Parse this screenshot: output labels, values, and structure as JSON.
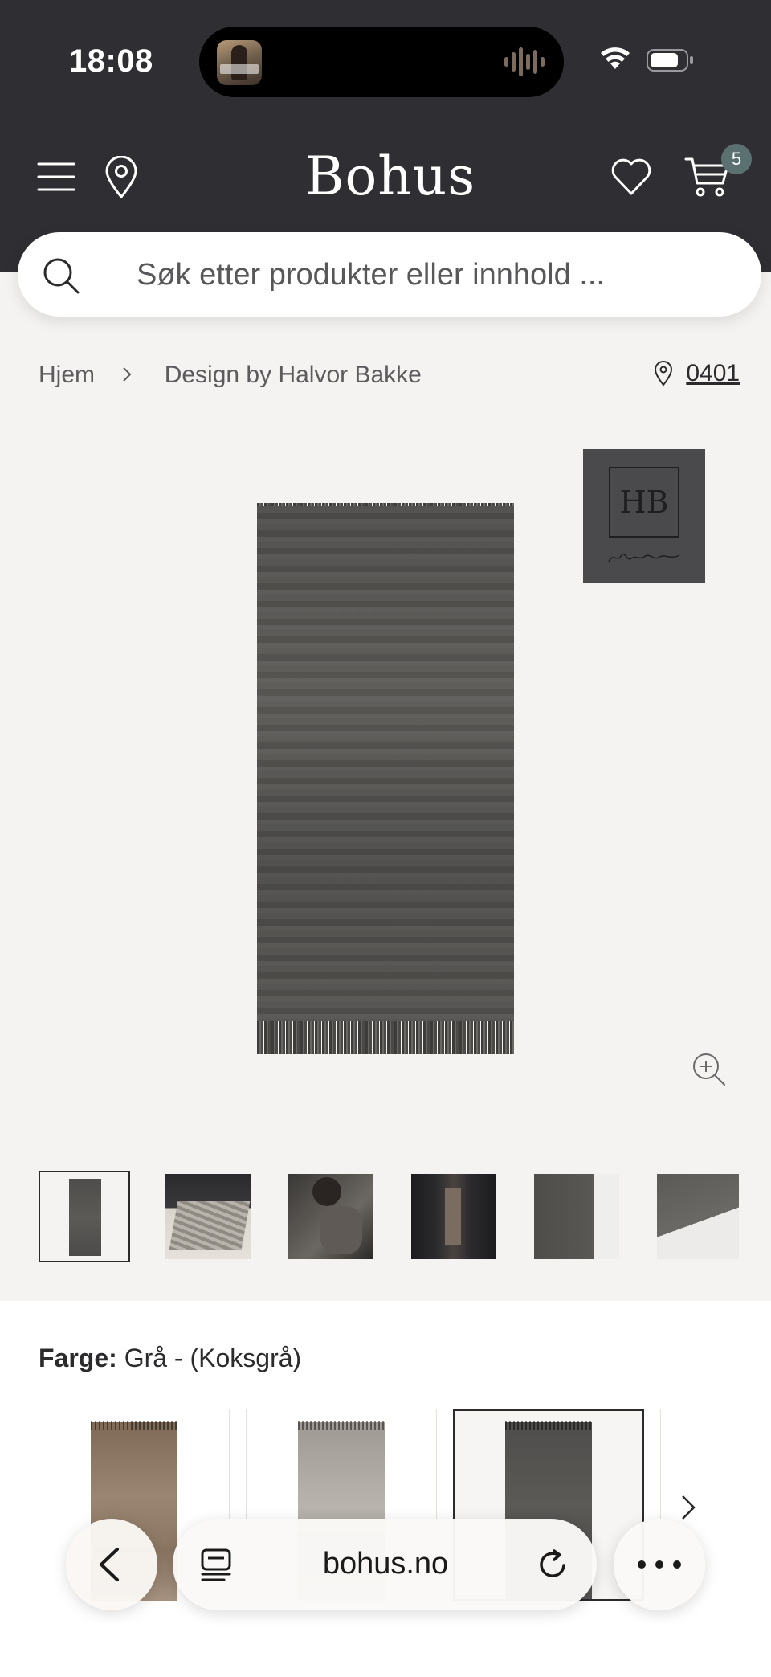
{
  "status_bar": {
    "time": "18:08"
  },
  "header": {
    "brand": "Bohus",
    "cart_count": "5",
    "colors": {
      "background": "#2f2f33",
      "badge": "#5b7070"
    }
  },
  "search": {
    "placeholder": "Søk etter produkter eller innhold ..."
  },
  "breadcrumb": {
    "items": [
      {
        "label": "Hjem"
      },
      {
        "label": "Design by Halvor Bakke"
      }
    ]
  },
  "store": {
    "code": "0401"
  },
  "product": {
    "brand_tile_text": "HB",
    "thumbnails": [
      {
        "name": "rug-front",
        "selected": true
      },
      {
        "name": "rug-in-hall",
        "selected": false
      },
      {
        "name": "person-with-rug",
        "selected": false
      },
      {
        "name": "dark-corridor",
        "selected": false
      },
      {
        "name": "rug-corner-detail",
        "selected": false
      },
      {
        "name": "rug-edge-detail",
        "selected": false
      }
    ]
  },
  "color": {
    "label": "Farge:",
    "value": "Grå - (Koksgrå)",
    "swatches": [
      {
        "name": "brown",
        "hex": "#8a7560",
        "selected": false
      },
      {
        "name": "light-grey",
        "hex": "#a9a49e",
        "selected": false
      },
      {
        "name": "charcoal",
        "hex": "#545250",
        "selected": true
      }
    ]
  },
  "browser": {
    "url": "bohus.no"
  }
}
